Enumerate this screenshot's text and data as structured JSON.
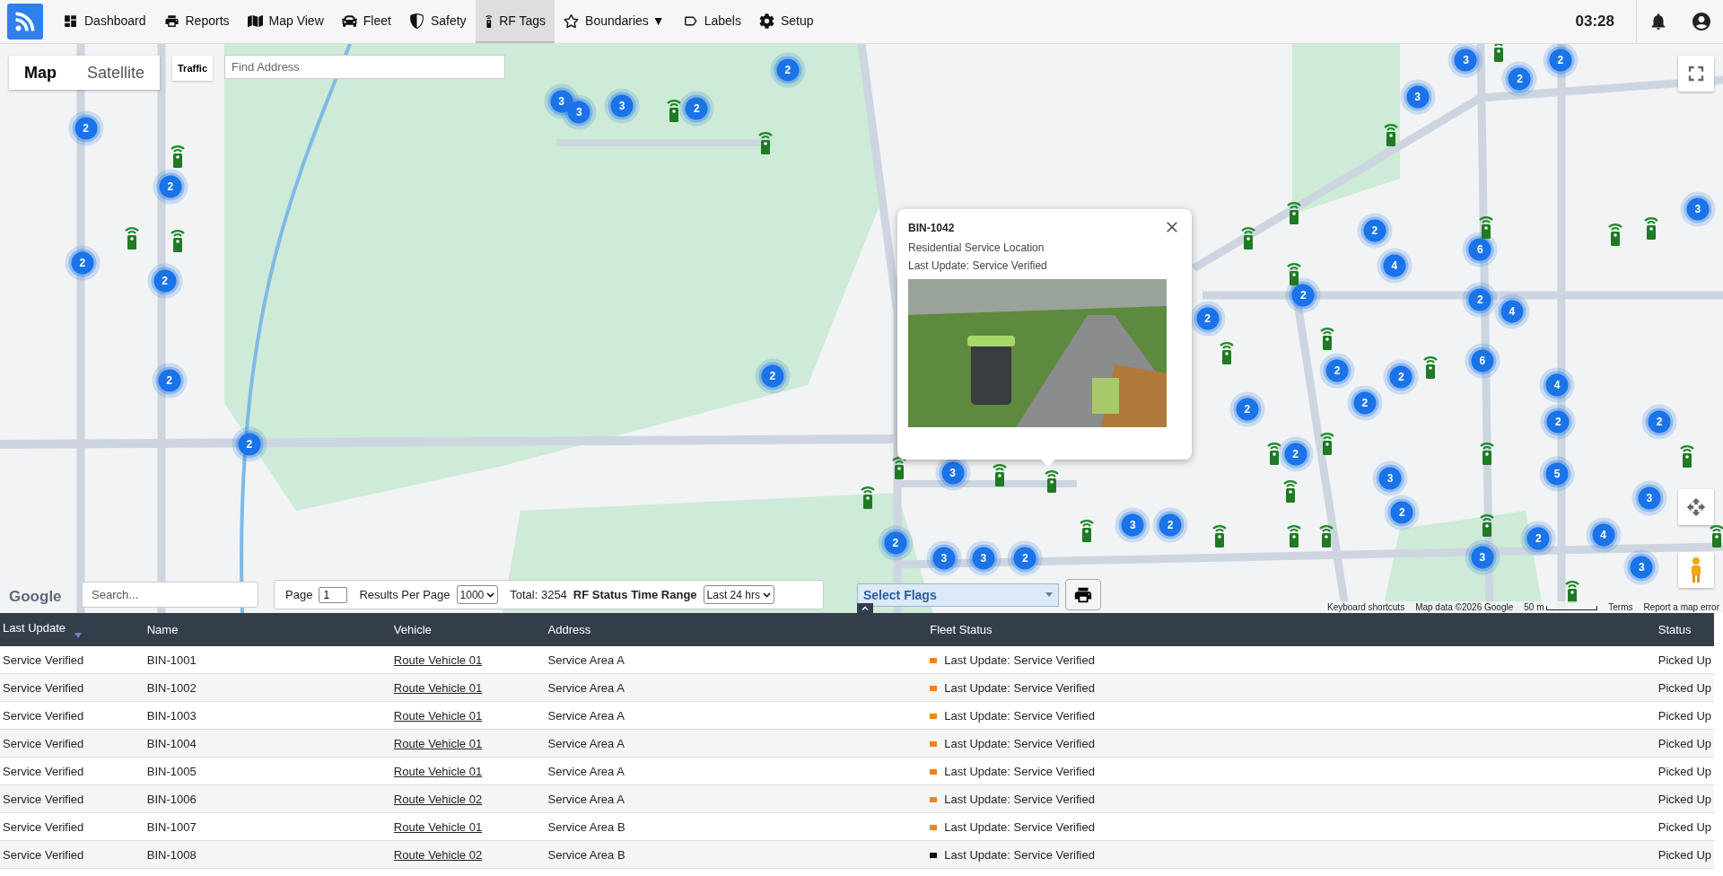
{
  "nav": {
    "items": [
      {
        "label": "Dashboard",
        "selected": false
      },
      {
        "label": "Reports",
        "selected": false
      },
      {
        "label": "Map View",
        "selected": false
      },
      {
        "label": "Fleet",
        "selected": false
      },
      {
        "label": "Safety",
        "selected": false
      },
      {
        "label": "RF Tags",
        "selected": true
      },
      {
        "label": "Boundaries ▼",
        "selected": false
      },
      {
        "label": "Labels",
        "selected": false
      },
      {
        "label": "Setup",
        "selected": false
      }
    ],
    "time": "03:28"
  },
  "map": {
    "type_tabs": [
      {
        "label": "Map",
        "selected": true
      },
      {
        "label": "Satellite",
        "selected": false
      }
    ],
    "traffic_button": "Traffic",
    "address_search": {
      "placeholder": "Find Address"
    },
    "markers": [
      {
        "kind": "cluster",
        "count": "2"
      },
      {
        "kind": "cluster",
        "count": "2"
      },
      {
        "kind": "cluster",
        "count": "2"
      },
      {
        "kind": "cluster",
        "count": "2"
      },
      {
        "kind": "cluster",
        "count": "2"
      },
      {
        "kind": "cluster",
        "count": "2"
      },
      {
        "kind": "cluster",
        "count": "3"
      },
      {
        "kind": "cluster",
        "count": "3"
      },
      {
        "kind": "cluster",
        "count": "3"
      },
      {
        "kind": "cluster",
        "count": "2"
      },
      {
        "kind": "cluster",
        "count": "2"
      },
      {
        "kind": "cluster",
        "count": "2"
      },
      {
        "kind": "cluster",
        "count": "3"
      },
      {
        "kind": "cluster",
        "count": "2"
      },
      {
        "kind": "cluster",
        "count": "3"
      },
      {
        "kind": "cluster",
        "count": "3"
      },
      {
        "kind": "cluster",
        "count": "2"
      },
      {
        "kind": "cluster",
        "count": "3"
      },
      {
        "kind": "cluster",
        "count": "2"
      },
      {
        "kind": "cluster",
        "count": "2"
      },
      {
        "kind": "cluster",
        "count": "2"
      },
      {
        "kind": "cluster",
        "count": "2"
      },
      {
        "kind": "cluster",
        "count": "2"
      },
      {
        "kind": "cluster",
        "count": "2"
      },
      {
        "kind": "cluster",
        "count": "2"
      },
      {
        "kind": "cluster",
        "count": "2"
      },
      {
        "kind": "cluster",
        "count": "4"
      },
      {
        "kind": "cluster",
        "count": "2"
      },
      {
        "kind": "cluster",
        "count": "3"
      },
      {
        "kind": "cluster",
        "count": "2"
      },
      {
        "kind": "cluster",
        "count": "3"
      },
      {
        "kind": "cluster",
        "count": "3"
      },
      {
        "kind": "cluster",
        "count": "2"
      },
      {
        "kind": "cluster",
        "count": "2"
      },
      {
        "kind": "cluster",
        "count": "6"
      },
      {
        "kind": "cluster",
        "count": "2"
      },
      {
        "kind": "cluster",
        "count": "4"
      },
      {
        "kind": "cluster",
        "count": "6"
      },
      {
        "kind": "cluster",
        "count": "4"
      },
      {
        "kind": "cluster",
        "count": "2"
      },
      {
        "kind": "cluster",
        "count": "5"
      },
      {
        "kind": "cluster",
        "count": "2"
      },
      {
        "kind": "cluster",
        "count": "4"
      },
      {
        "kind": "cluster",
        "count": "3"
      },
      {
        "kind": "cluster",
        "count": "3"
      },
      {
        "kind": "cluster",
        "count": "3"
      },
      {
        "kind": "cluster",
        "count": "2"
      },
      {
        "kind": "cluster",
        "count": "3"
      },
      {
        "kind": "tag"
      },
      {
        "kind": "tag"
      },
      {
        "kind": "tag"
      },
      {
        "kind": "tag"
      },
      {
        "kind": "tag"
      },
      {
        "kind": "tag"
      },
      {
        "kind": "tag"
      },
      {
        "kind": "tag"
      },
      {
        "kind": "tag"
      },
      {
        "kind": "tag"
      },
      {
        "kind": "tag"
      },
      {
        "kind": "tag"
      },
      {
        "kind": "tag"
      },
      {
        "kind": "tag"
      },
      {
        "kind": "tag"
      },
      {
        "kind": "tag"
      },
      {
        "kind": "tag"
      },
      {
        "kind": "tag"
      },
      {
        "kind": "tag"
      },
      {
        "kind": "tag"
      },
      {
        "kind": "tag"
      },
      {
        "kind": "tag"
      },
      {
        "kind": "tag"
      },
      {
        "kind": "tag"
      },
      {
        "kind": "tag"
      },
      {
        "kind": "tag"
      },
      {
        "kind": "tag"
      },
      {
        "kind": "tag"
      },
      {
        "kind": "tag"
      },
      {
        "kind": "tag"
      },
      {
        "kind": "tag"
      },
      {
        "kind": "tag"
      }
    ],
    "popup": {
      "title": "BIN-1042",
      "subtitle": "Residential Service Location",
      "update": "Last Update: Service Verified"
    },
    "google_logo": "Google",
    "attribution": [
      "Keyboard shortcuts",
      "Map data ©2026 Google",
      "50 m",
      "Terms",
      "Report a map error"
    ]
  },
  "toolbar": {
    "search": {
      "placeholder": "Search..."
    },
    "page_label": "Page",
    "page": "1",
    "per_page_label": "Results Per Page",
    "per_page": "1000",
    "total": "Total: 3254",
    "range_label": "RF Status Time Range",
    "range": "Last 24 hrs",
    "flags": "Select Flags"
  },
  "table": {
    "columns": [
      {
        "label": "Last Update",
        "sorted": true
      },
      {
        "label": "Name",
        "sorted": false
      },
      {
        "label": "Vehicle",
        "sorted": false
      },
      {
        "label": "Address",
        "sorted": false
      },
      {
        "label": "Fleet Status",
        "sorted": false
      },
      {
        "label": "Status",
        "sorted": false
      }
    ],
    "rows": [
      {
        "last_update": "Service Verified",
        "name": "BIN-1001",
        "vehicle": "Route Vehicle 01",
        "address": "Service Area A",
        "fleet_status": "Last Update: Service Verified",
        "color": "#f5821f",
        "status": "Picked Up"
      },
      {
        "last_update": "Service Verified",
        "name": "BIN-1002",
        "vehicle": "Route Vehicle 01",
        "address": "Service Area A",
        "fleet_status": "Last Update: Service Verified",
        "color": "#f5821f",
        "status": "Picked Up"
      },
      {
        "last_update": "Service Verified",
        "name": "BIN-1003",
        "vehicle": "Route Vehicle 01",
        "address": "Service Area A",
        "fleet_status": "Last Update: Service Verified",
        "color": "#f5821f",
        "status": "Picked Up"
      },
      {
        "last_update": "Service Verified",
        "name": "BIN-1004",
        "vehicle": "Route Vehicle 01",
        "address": "Service Area A",
        "fleet_status": "Last Update: Service Verified",
        "color": "#f5821f",
        "status": "Picked Up"
      },
      {
        "last_update": "Service Verified",
        "name": "BIN-1005",
        "vehicle": "Route Vehicle 01",
        "address": "Service Area A",
        "fleet_status": "Last Update: Service Verified",
        "color": "#f5821f",
        "status": "Picked Up"
      },
      {
        "last_update": "Service Verified",
        "name": "BIN-1006",
        "vehicle": "Route Vehicle 02",
        "address": "Service Area A",
        "fleet_status": "Last Update: Service Verified",
        "color": "#f5821f",
        "status": "Picked Up"
      },
      {
        "last_update": "Service Verified",
        "name": "BIN-1007",
        "vehicle": "Route Vehicle 01",
        "address": "Service Area B",
        "fleet_status": "Last Update: Service Verified",
        "color": "#f5821f",
        "status": "Picked Up"
      },
      {
        "last_update": "Service Verified",
        "name": "BIN-1008",
        "vehicle": "Route Vehicle 02",
        "address": "Service Area B",
        "fleet_status": "Last Update: Service Verified",
        "color": "#111111",
        "status": "Picked Up"
      }
    ]
  }
}
